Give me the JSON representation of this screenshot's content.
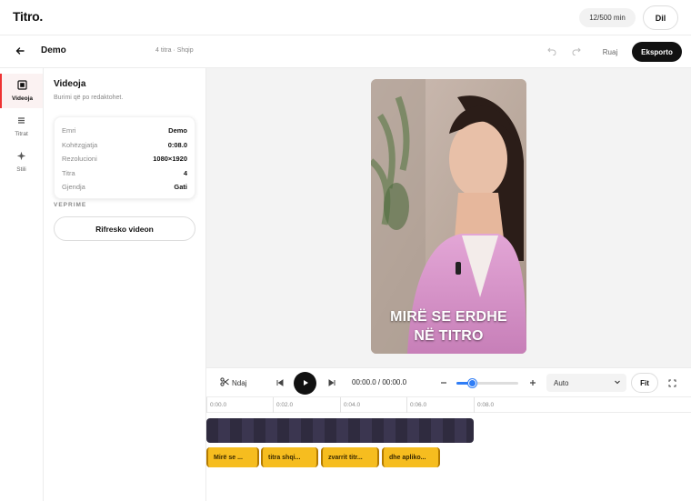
{
  "app": {
    "logo": "Titro.",
    "minutes": "12/500 min",
    "exit_label": "Dil"
  },
  "toolbar": {
    "back_icon": "arrow-left-icon",
    "project_title": "Demo",
    "project_meta": "4 titra · Shqip",
    "save_label": "Ruaj",
    "export_label": "Eksporto"
  },
  "rail": [
    {
      "label": "Videoja",
      "icon": "video-icon",
      "active": true
    },
    {
      "label": "Titrat",
      "icon": "list-icon",
      "active": false
    },
    {
      "label": "Stili",
      "icon": "sparkle-icon",
      "active": false
    }
  ],
  "panel": {
    "title": "Videoja",
    "subtitle": "Burimi që po redaktohet.",
    "info": [
      {
        "key": "Emri",
        "value": "Demo"
      },
      {
        "key": "Kohëzgjatja",
        "value": "0:08.0"
      },
      {
        "key": "Rezolucioni",
        "value": "1080×1920"
      },
      {
        "key": "Titra",
        "value": "4"
      },
      {
        "key": "Gjendja",
        "value": "Gati"
      }
    ],
    "section_label": "VEPRIME",
    "refresh_label": "Rifresko videon"
  },
  "preview": {
    "caption_lines": [
      "MIRË SE ERDHE",
      "NË TITRO"
    ]
  },
  "controls": {
    "split_label": "Ndaj",
    "time": "00:00.0 / 00:00.0",
    "zoom_level": 0.25,
    "zoom_select": "Auto",
    "fit_label": "Fit"
  },
  "timeline": {
    "ticks": [
      "0:00.0",
      "0:02.0",
      "0:04.0",
      "0:06.0",
      "0:08.0"
    ],
    "chips": [
      "Mirë se ...",
      "titra shqi...",
      "zvarrit titr...",
      "dhe apliko..."
    ]
  },
  "colors": {
    "accent": "#111111",
    "active_marker": "#e33333",
    "caption_chip": "#f6bd1f",
    "video_track": "#2f2b3f",
    "zoom": "#2f7df6"
  }
}
